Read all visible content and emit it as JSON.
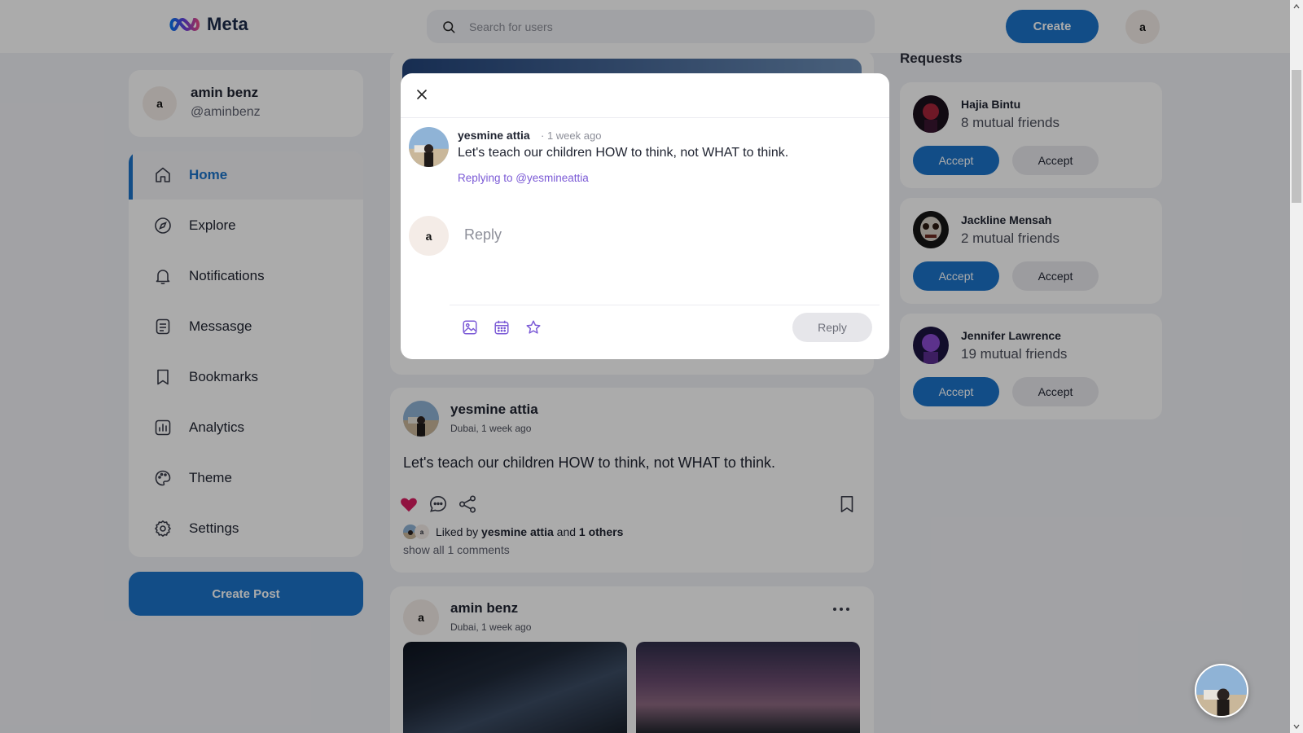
{
  "header": {
    "logo_text": "Meta",
    "search_placeholder": "Search for users",
    "create_label": "Create",
    "avatar_initial": "a"
  },
  "profile": {
    "name": "amin benz",
    "handle": "@aminbenz",
    "initial": "a"
  },
  "sidebar": {
    "items": [
      {
        "label": "Home",
        "icon": "home-icon",
        "active": true
      },
      {
        "label": "Explore",
        "icon": "compass-icon"
      },
      {
        "label": "Notifications",
        "icon": "bell-icon"
      },
      {
        "label": "Messasge",
        "icon": "message-icon"
      },
      {
        "label": "Bookmarks",
        "icon": "bookmark-icon"
      },
      {
        "label": "Analytics",
        "icon": "analytics-icon"
      },
      {
        "label": "Theme",
        "icon": "palette-icon"
      },
      {
        "label": "Settings",
        "icon": "gear-icon"
      }
    ],
    "create_post_label": "Create Post"
  },
  "modal": {
    "author": "yesmine attia",
    "time": "· 1 week ago",
    "text": "Let's teach our children HOW to think, not WHAT to think.",
    "replying_to": "Replying to @yesmineattia",
    "reply_avatar_initial": "a",
    "reply_placeholder": "Reply",
    "reply_button": "Reply",
    "tools": [
      "image-icon",
      "calendar-icon",
      "star-icon"
    ]
  },
  "feed": {
    "post1": {
      "author": "yesmine attia",
      "meta": "Dubai, 1 week ago",
      "text": "Let's teach our children HOW to think, not WHAT to think.",
      "liked_prefix": "Liked by",
      "liked_user": "yesmine attia",
      "liked_and": "and",
      "liked_others": "1 others",
      "comments_link": "show all 1 comments",
      "liked": true
    },
    "post2": {
      "author": "amin benz",
      "meta": "Dubai, 1 week ago",
      "initial": "a"
    }
  },
  "requests": {
    "title": "Requests",
    "items": [
      {
        "name": "Hajia Bintu",
        "mutual": "8 mutual friends",
        "accept": "Accept",
        "second": "Accept"
      },
      {
        "name": "Jackline Mensah",
        "mutual": "2 mutual friends",
        "accept": "Accept",
        "second": "Accept"
      },
      {
        "name": "Jennifer Lawrence",
        "mutual": "19 mutual friends",
        "accept": "Accept",
        "second": "Accept"
      }
    ]
  },
  "colors": {
    "primary": "#1b74c9",
    "accent_purple": "#7b5ad6",
    "like": "#d81b60",
    "background": "#f1f2f6"
  }
}
